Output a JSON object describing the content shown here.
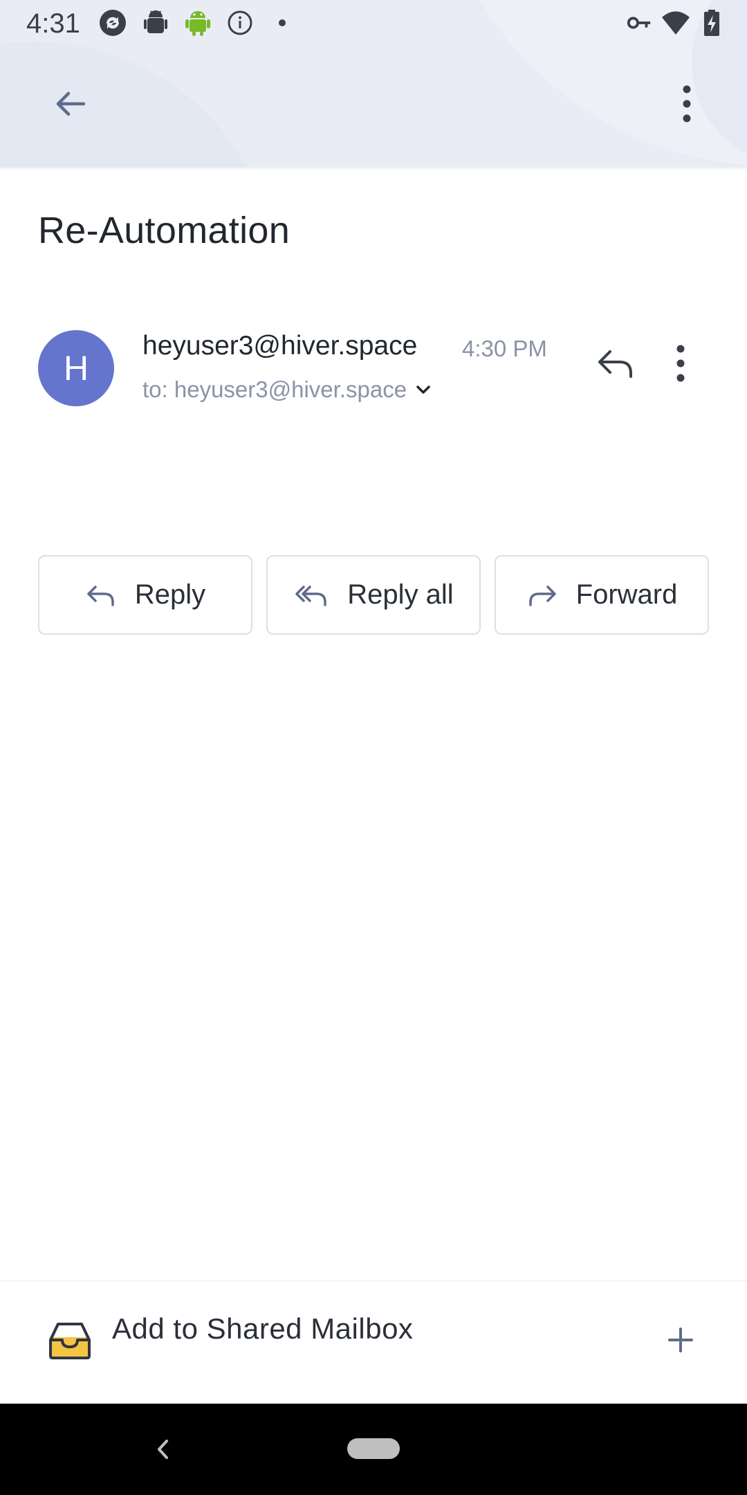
{
  "status_bar": {
    "time": "4:31",
    "left_icons": [
      "sync-icon",
      "android-debug-icon",
      "android-icon",
      "info-icon",
      "dot-icon"
    ],
    "right_icons": [
      "vpn-key-icon",
      "wifi-icon",
      "battery-charging-icon"
    ]
  },
  "app_bar": {
    "back_icon": "arrow-left-icon",
    "menu_icon": "more-vertical-icon"
  },
  "email": {
    "subject": "Re-Automation",
    "avatar_initial": "H",
    "avatar_color": "#6574cd",
    "sender": "heyuser3@hiver.space",
    "time": "4:30 PM",
    "recipient": "to: heyuser3@hiver.space"
  },
  "actions": {
    "reply": "Reply",
    "reply_all": "Reply all",
    "forward": "Forward"
  },
  "bottom": {
    "shared_mailbox_label": "Add to Shared Mailbox",
    "inbox_icon": "inbox-icon",
    "add_icon": "plus-icon"
  },
  "colors": {
    "header_bg": "#e9ecf5",
    "accent": "#6574cd",
    "muted_text": "#8a93a6"
  }
}
